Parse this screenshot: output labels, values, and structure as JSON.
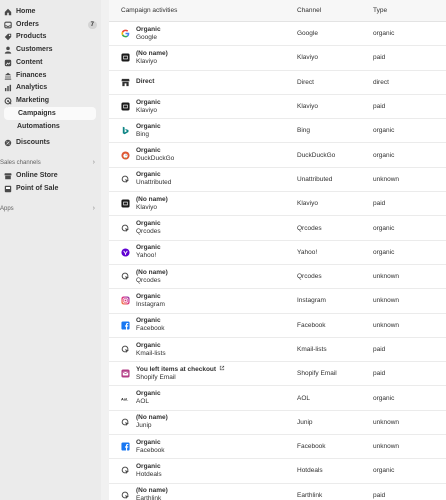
{
  "sidebar": {
    "items": [
      {
        "label": "Home",
        "icon": "home-icon"
      },
      {
        "label": "Orders",
        "icon": "orders-icon",
        "badge": "7"
      },
      {
        "label": "Products",
        "icon": "products-icon"
      },
      {
        "label": "Customers",
        "icon": "customers-icon"
      },
      {
        "label": "Content",
        "icon": "content-icon"
      },
      {
        "label": "Finances",
        "icon": "finances-icon"
      },
      {
        "label": "Analytics",
        "icon": "analytics-icon"
      },
      {
        "label": "Marketing",
        "icon": "marketing-icon"
      }
    ],
    "marketing_sub": [
      {
        "label": "Campaigns",
        "active": true
      },
      {
        "label": "Automations",
        "active": false
      }
    ],
    "discounts": "Discounts",
    "sales_channels_label": "Sales channels",
    "channels": [
      {
        "label": "Online Store",
        "icon": "online-store-icon"
      },
      {
        "label": "Point of Sale",
        "icon": "point-of-sale-icon"
      }
    ],
    "apps_label": "Apps"
  },
  "table": {
    "headers": {
      "activity": "Campaign activities",
      "channel": "Channel",
      "type": "Type"
    },
    "rows": [
      {
        "title": "Organic",
        "sub": "Google",
        "channel": "Google",
        "type": "organic",
        "icon": "google-icon"
      },
      {
        "title": "(No name)",
        "sub": "Klaviyo",
        "channel": "Klaviyo",
        "type": "paid",
        "icon": "klaviyo-icon"
      },
      {
        "title": "Direct",
        "sub": "",
        "channel": "Direct",
        "type": "direct",
        "icon": "direct-icon"
      },
      {
        "title": "Organic",
        "sub": "Klaviyo",
        "channel": "Klaviyo",
        "type": "paid",
        "icon": "klaviyo-icon"
      },
      {
        "title": "Organic",
        "sub": "Bing",
        "channel": "Bing",
        "type": "organic",
        "icon": "bing-icon"
      },
      {
        "title": "Organic",
        "sub": "DuckDuckGo",
        "channel": "DuckDuckGo",
        "type": "organic",
        "icon": "duckduckgo-icon"
      },
      {
        "title": "Organic",
        "sub": "Unattributed",
        "channel": "Unattributed",
        "type": "unknown",
        "icon": "generic-link-icon"
      },
      {
        "title": "(No name)",
        "sub": "Klaviyo",
        "channel": "Klaviyo",
        "type": "paid",
        "icon": "klaviyo-icon"
      },
      {
        "title": "Organic",
        "sub": "Qrcodes",
        "channel": "Qrcodes",
        "type": "organic",
        "icon": "generic-link-icon"
      },
      {
        "title": "Organic",
        "sub": "Yahoo!",
        "channel": "Yahoo!",
        "type": "organic",
        "icon": "yahoo-icon"
      },
      {
        "title": "(No name)",
        "sub": "Qrcodes",
        "channel": "Qrcodes",
        "type": "unknown",
        "icon": "generic-link-icon"
      },
      {
        "title": "Organic",
        "sub": "Instagram",
        "channel": "Instagram",
        "type": "unknown",
        "icon": "instagram-icon"
      },
      {
        "title": "Organic",
        "sub": "Facebook",
        "channel": "Facebook",
        "type": "unknown",
        "icon": "facebook-icon"
      },
      {
        "title": "Organic",
        "sub": "Kmail-lists",
        "channel": "Kmail-lists",
        "type": "paid",
        "icon": "generic-link-icon"
      },
      {
        "title": "You left items at checkout",
        "sub": "Shopify Email",
        "channel": "Shopify Email",
        "type": "paid",
        "icon": "shopify-email-icon",
        "external": true
      },
      {
        "title": "Organic",
        "sub": "AOL",
        "channel": "AOL",
        "type": "organic",
        "icon": "aol-icon"
      },
      {
        "title": "(No name)",
        "sub": "Junip",
        "channel": "Junip",
        "type": "unknown",
        "icon": "generic-link-icon"
      },
      {
        "title": "Organic",
        "sub": "Facebook",
        "channel": "Facebook",
        "type": "unknown",
        "icon": "facebook-icon"
      },
      {
        "title": "Organic",
        "sub": "Hotdeals",
        "channel": "Hotdeals",
        "type": "organic",
        "icon": "generic-link-icon"
      },
      {
        "title": "(No name)",
        "sub": "Earthlink",
        "channel": "Earthlink",
        "type": "paid",
        "icon": "generic-link-icon"
      }
    ]
  }
}
